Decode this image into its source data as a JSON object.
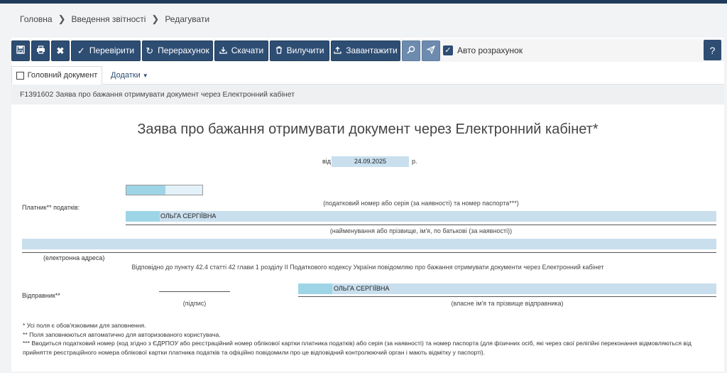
{
  "breadcrumb": {
    "items": [
      "Головна",
      "Введення звітності",
      "Редагувати"
    ]
  },
  "toolbar": {
    "save_icon": "save-icon",
    "print_icon": "print-icon",
    "close_icon": "close-icon",
    "check_label": "Перевірити",
    "recalc_label": "Перерахунок",
    "download_label": "Скачати",
    "delete_label": "Вилучити",
    "upload_label": "Завантажити",
    "search_icon": "search-icon",
    "send_icon": "send-icon",
    "auto_calc_label": "Авто розрахунок",
    "auto_calc_checked": true,
    "help_label": "?"
  },
  "tabs": {
    "main_doc": "Головний документ",
    "attachments": "Додатки"
  },
  "document": {
    "code_title": "F1391602 Заява про бажання отримувати документ через Електронний кабінет",
    "title": "Заява про бажання отримувати документ через Електронний кабінет*",
    "date_prefix": "від",
    "date_value": "24.09.2025",
    "date_suffix": "р.",
    "payer_label": "Платник** податків:",
    "tax_number_caption": "(податковий номер або серія (за наявності) та номер паспорта***)",
    "payer_name_value": "ОЛЬГА СЕРГІЇВНА",
    "name_caption": "(найменування або прізвище, ім'я, по батькові (за наявності))",
    "email_caption": "(електронна адреса)",
    "statement": "Відповідно до пункту 42.4 статті 42 глави 1 розділу II Податкового кодексу України повідомляю про бажання отримувати документи через Електронний кабінет",
    "sender_label": "Відправник**",
    "signature_caption": "(підпис)",
    "sender_name_value": "ОЛЬГА СЕРГІЇВНА",
    "sender_name_caption": "(власне ім'я та прізвище відправника)",
    "note1": "* Усі поля є обов'язковими для заповнення.",
    "note2": "** Поля заповнюються автоматично для авторизованого користувача.",
    "note3": "*** Вводиться податковий номер (код згідно з ЄДРПОУ або реєстраційний номер облікової картки платника податків) або серія (за наявності) та номер паспорта (для фізичних осіб, які через свої релігійні переконання відмовляються від прийняття реєстраційного номера облікової картки платника податків та офіційно повідомили про це відповідний контролюючий орган і мають відмітку у паспорті)."
  },
  "colors": {
    "primary": "#2e4d73",
    "primary_light": "#6d8bae",
    "field": "#c9dfee",
    "field_accent": "#9ed5e6"
  }
}
